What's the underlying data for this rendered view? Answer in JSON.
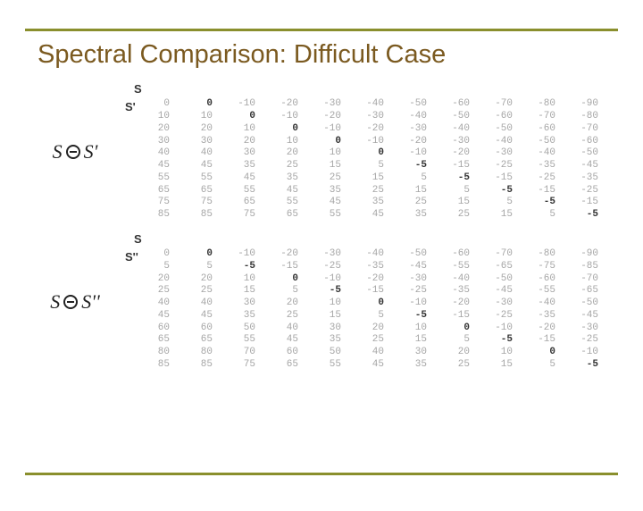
{
  "title": "Spectral Comparison: Difficult Case",
  "labels": {
    "sym_S": "S",
    "sym_Sp": "S'",
    "sym_Spp": "S''",
    "axis_top": "S",
    "axis_left_1": "S'",
    "axis_left_2": "S''"
  },
  "table1": {
    "row_headers": [
      "0",
      "10",
      "20",
      "30",
      "40",
      "45",
      "55",
      "65",
      "75",
      "85"
    ],
    "rows": [
      [
        "0",
        "-10",
        "-20",
        "-30",
        "-40",
        "-50",
        "-60",
        "-70",
        "-80",
        "-90"
      ],
      [
        "10",
        "0",
        "-10",
        "-20",
        "-30",
        "-40",
        "-50",
        "-60",
        "-70",
        "-80"
      ],
      [
        "20",
        "10",
        "0",
        "-10",
        "-20",
        "-30",
        "-40",
        "-50",
        "-60",
        "-70"
      ],
      [
        "30",
        "20",
        "10",
        "0",
        "-10",
        "-20",
        "-30",
        "-40",
        "-50",
        "-60"
      ],
      [
        "40",
        "30",
        "20",
        "10",
        "0",
        "-10",
        "-20",
        "-30",
        "-40",
        "-50"
      ],
      [
        "45",
        "35",
        "25",
        "15",
        "5",
        "-5",
        "-15",
        "-25",
        "-35",
        "-45"
      ],
      [
        "55",
        "45",
        "35",
        "25",
        "15",
        "5",
        "-5",
        "-15",
        "-25",
        "-35"
      ],
      [
        "65",
        "55",
        "45",
        "35",
        "25",
        "15",
        "5",
        "-5",
        "-15",
        "-25"
      ],
      [
        "75",
        "65",
        "55",
        "45",
        "35",
        "25",
        "15",
        "5",
        "-5",
        "-15"
      ],
      [
        "85",
        "75",
        "65",
        "55",
        "45",
        "35",
        "25",
        "15",
        "5",
        "-5"
      ]
    ]
  },
  "table2": {
    "row_headers": [
      "0",
      "5",
      "20",
      "25",
      "40",
      "45",
      "60",
      "65",
      "80",
      "85"
    ],
    "rows": [
      [
        "0",
        "-10",
        "-20",
        "-30",
        "-40",
        "-50",
        "-60",
        "-70",
        "-80",
        "-90"
      ],
      [
        "5",
        "-5",
        "-15",
        "-25",
        "-35",
        "-45",
        "-55",
        "-65",
        "-75",
        "-85"
      ],
      [
        "20",
        "10",
        "0",
        "-10",
        "-20",
        "-30",
        "-40",
        "-50",
        "-60",
        "-70"
      ],
      [
        "25",
        "15",
        "5",
        "-5",
        "-15",
        "-25",
        "-35",
        "-45",
        "-55",
        "-65"
      ],
      [
        "40",
        "30",
        "20",
        "10",
        "0",
        "-10",
        "-20",
        "-30",
        "-40",
        "-50"
      ],
      [
        "45",
        "35",
        "25",
        "15",
        "5",
        "-5",
        "-15",
        "-25",
        "-35",
        "-45"
      ],
      [
        "60",
        "50",
        "40",
        "30",
        "20",
        "10",
        "0",
        "-10",
        "-20",
        "-30"
      ],
      [
        "65",
        "55",
        "45",
        "35",
        "25",
        "15",
        "5",
        "-5",
        "-15",
        "-25"
      ],
      [
        "80",
        "70",
        "60",
        "50",
        "40",
        "30",
        "20",
        "10",
        "0",
        "-10"
      ],
      [
        "85",
        "75",
        "65",
        "55",
        "45",
        "35",
        "25",
        "15",
        "5",
        "-5"
      ]
    ]
  },
  "colors": {
    "accent": "#8a8f2d",
    "title": "#7b5a20",
    "muted": "#a6a6a6",
    "diag": "#333333"
  }
}
